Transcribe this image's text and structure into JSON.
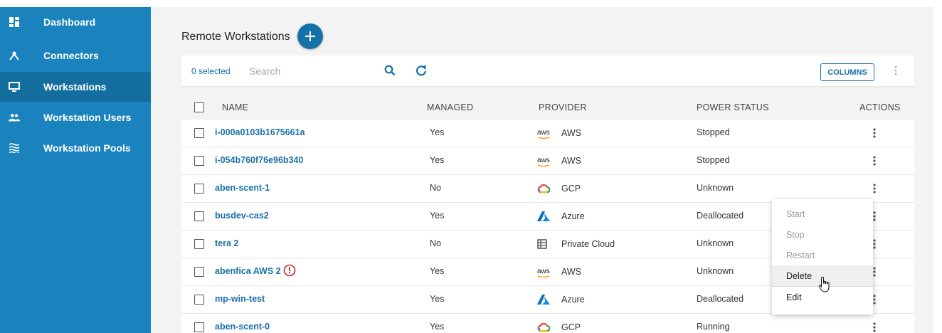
{
  "sidebar": {
    "items": [
      {
        "label": "Dashboard",
        "icon": "dashboard-icon"
      },
      {
        "label": "Connectors",
        "icon": "connectors-icon"
      },
      {
        "label": "Workstations",
        "icon": "monitor-icon",
        "active": true
      },
      {
        "label": "Workstation Users",
        "icon": "users-icon"
      },
      {
        "label": "Workstation Pools",
        "icon": "pools-icon"
      }
    ]
  },
  "header": {
    "title": "Remote Workstations",
    "add_icon": "plus-icon"
  },
  "toolbar": {
    "selected": "0 selected",
    "search_placeholder": "Search",
    "columns_label": "COLUMNS"
  },
  "table": {
    "headers": {
      "name": "NAME",
      "managed": "MANAGED",
      "provider": "PROVIDER",
      "power": "POWER STATUS",
      "actions": "ACTIONS"
    },
    "rows": [
      {
        "name": "i-000a0103b1675661a",
        "managed": "Yes",
        "provider": "AWS",
        "provider_icon": "aws-icon",
        "power": "Stopped"
      },
      {
        "name": "i-054b760f76e96b340",
        "managed": "Yes",
        "provider": "AWS",
        "provider_icon": "aws-icon",
        "power": "Stopped"
      },
      {
        "name": "aben-scent-1",
        "managed": "No",
        "provider": "GCP",
        "provider_icon": "gcp-icon",
        "power": "Unknown"
      },
      {
        "name": "busdev-cas2",
        "managed": "Yes",
        "provider": "Azure",
        "provider_icon": "azure-icon",
        "power": "Deallocated"
      },
      {
        "name": "tera 2",
        "managed": "No",
        "provider": "Private Cloud",
        "provider_icon": "server-icon",
        "power": "Unknown"
      },
      {
        "name": "abenfica AWS 2",
        "managed": "Yes",
        "provider": "AWS",
        "provider_icon": "aws-icon",
        "power": "Unknown",
        "warning": true
      },
      {
        "name": "mp-win-test",
        "managed": "Yes",
        "provider": "Azure",
        "provider_icon": "azure-icon",
        "power": "Deallocated"
      },
      {
        "name": "aben-scent-0",
        "managed": "Yes",
        "provider": "GCP",
        "provider_icon": "gcp-icon",
        "power": "Running"
      }
    ]
  },
  "aws_logo_text": "aws",
  "context_menu": {
    "items": [
      {
        "label": "Start",
        "enabled": false
      },
      {
        "label": "Stop",
        "enabled": false
      },
      {
        "label": "Restart",
        "enabled": false
      },
      {
        "label": "Delete",
        "enabled": true,
        "hovered": true
      },
      {
        "label": "Edit",
        "enabled": true
      }
    ]
  },
  "colors": {
    "sidebar": "#1a83bd",
    "sidebar_active": "#136e9f",
    "accent": "#1a6fa8",
    "add_button": "#1671a9",
    "warning": "#c62828"
  }
}
